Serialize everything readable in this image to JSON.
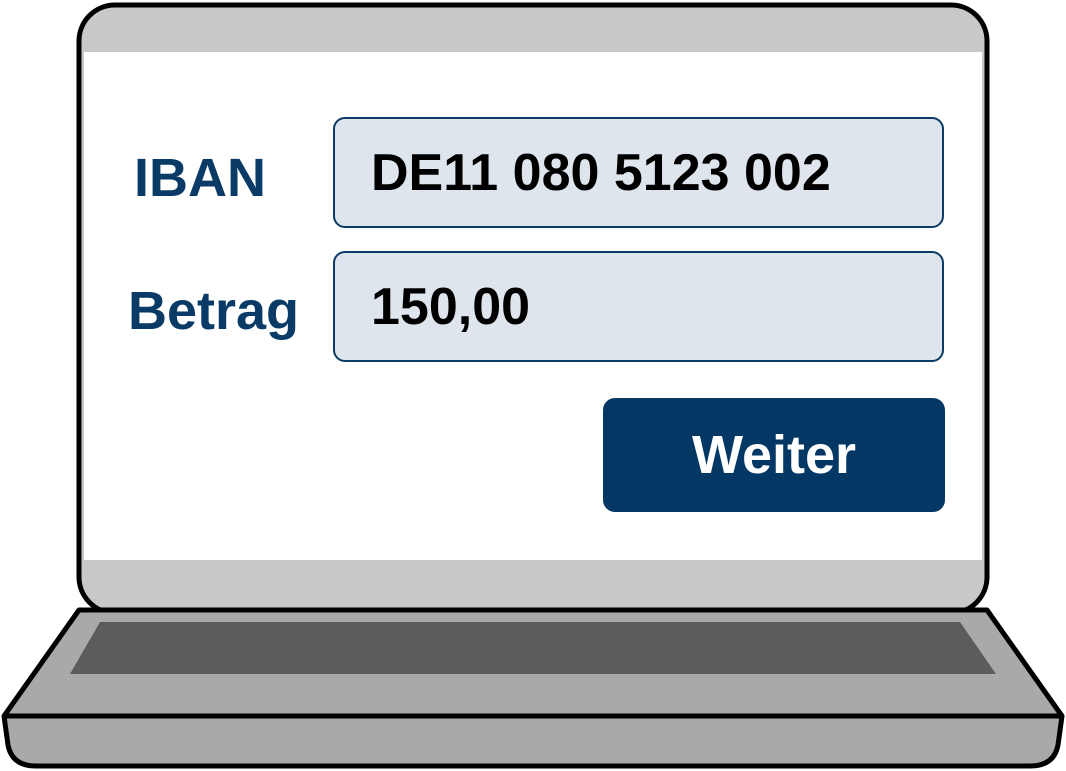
{
  "form": {
    "iban_label": "IBAN",
    "iban_value": "DE11 080 5123 002",
    "amount_label": "Betrag",
    "amount_value": "150,00",
    "continue_label": "Weiter"
  },
  "colors": {
    "label_text": "#0a3a66",
    "field_background": "#dfe5ec",
    "button_background": "#033764",
    "button_text": "#ffffff",
    "laptop_frame": "#c8c8c8",
    "laptop_keyboard": "#5c5c5c"
  },
  "icons": {
    "device": "laptop-icon"
  }
}
